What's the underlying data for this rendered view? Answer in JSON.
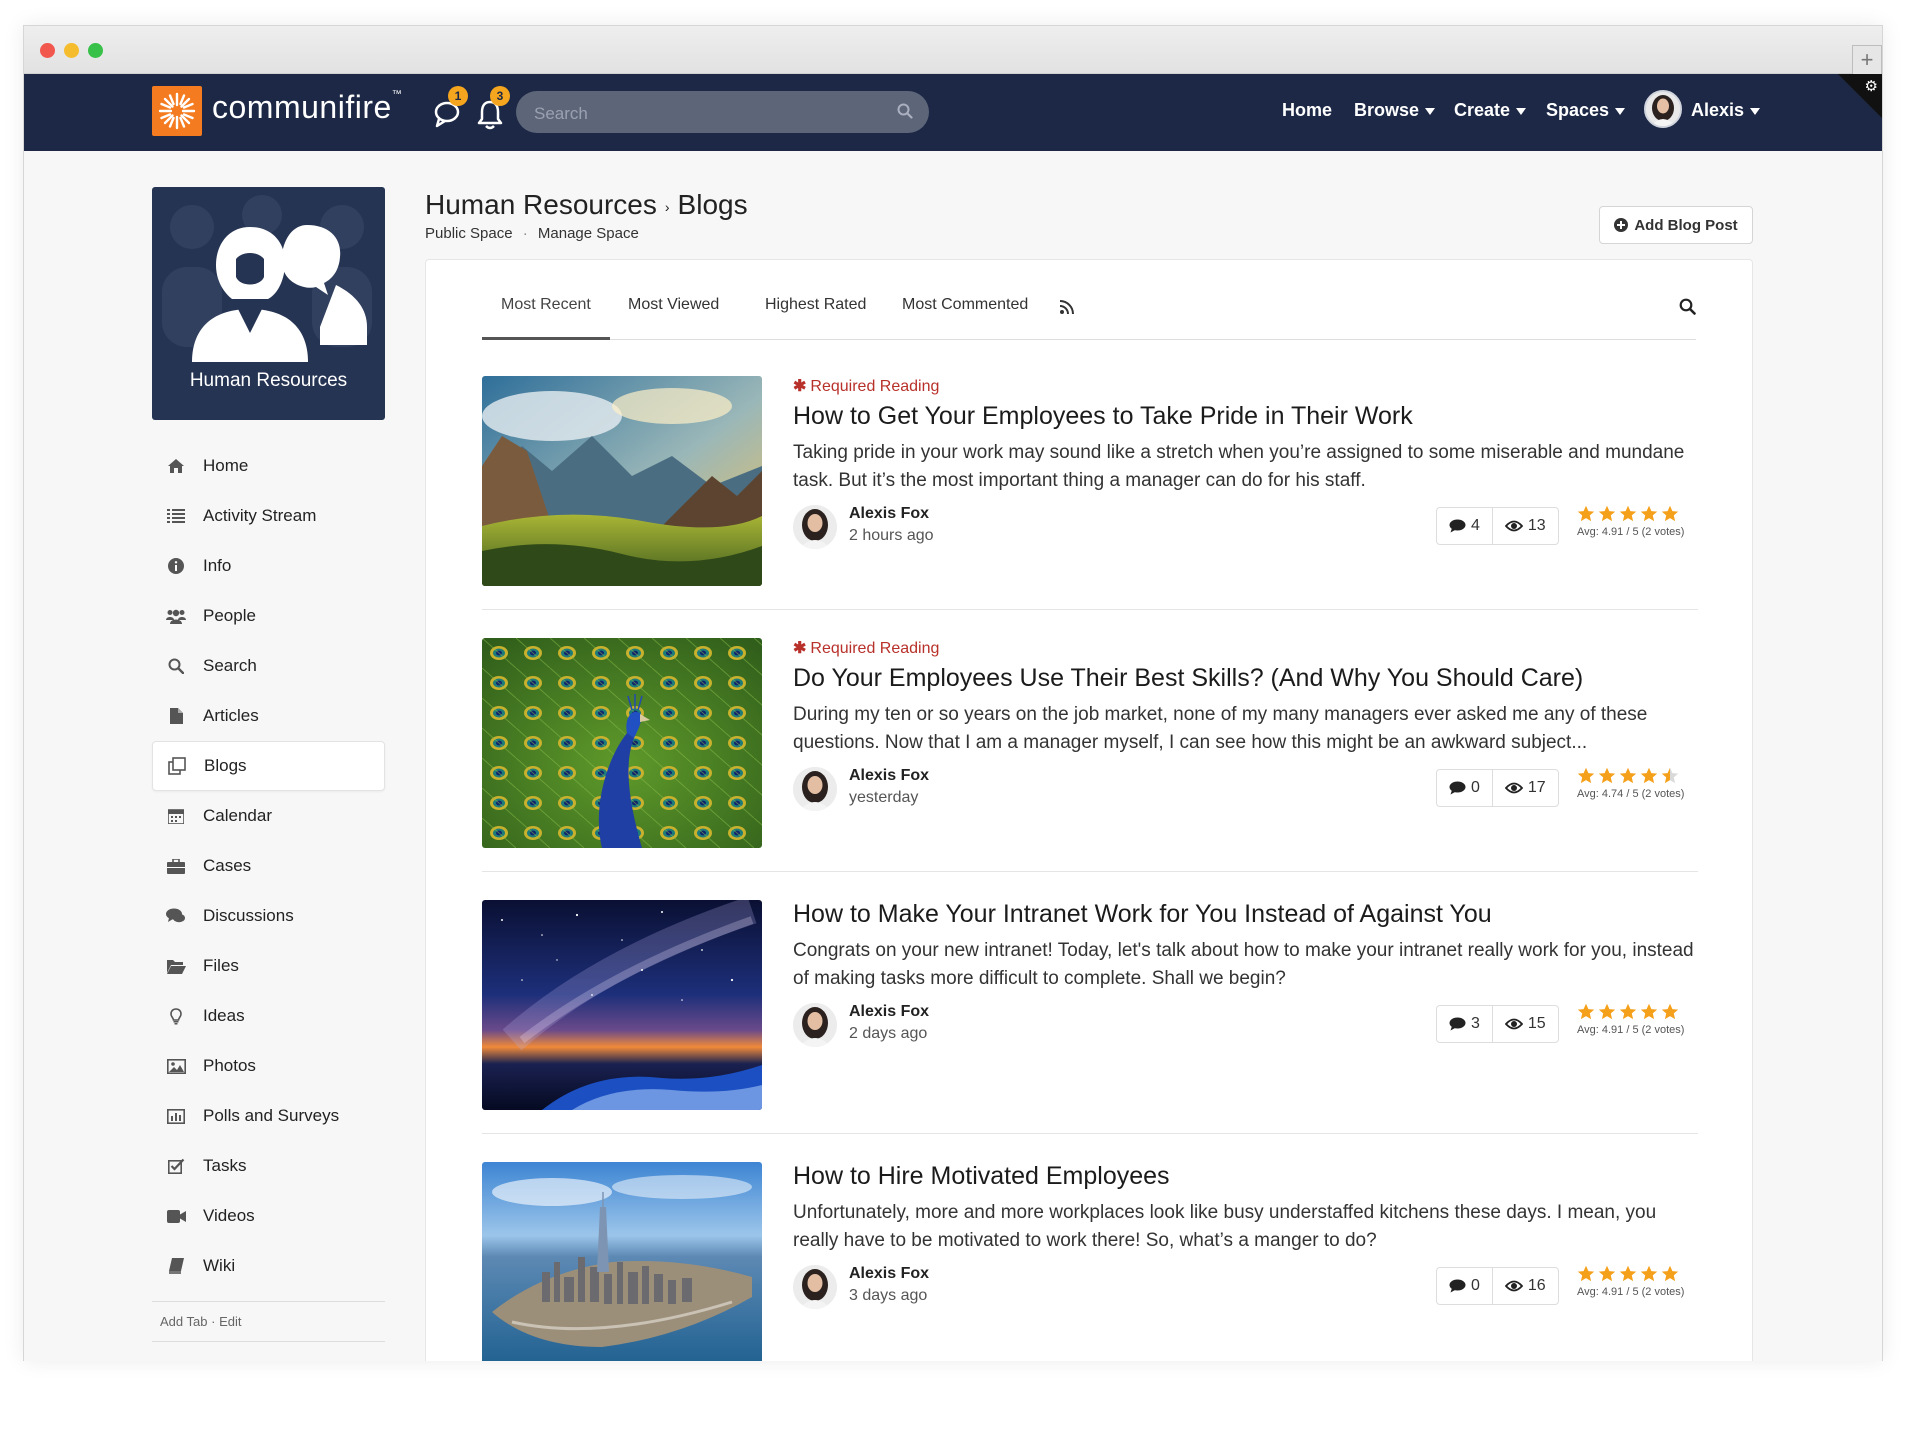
{
  "brand": {
    "name": "communifire",
    "tm": "™"
  },
  "header": {
    "chat_badge": "1",
    "notif_badge": "3",
    "search_placeholder": "Search",
    "nav": [
      {
        "label": "Home"
      },
      {
        "label": "Browse"
      },
      {
        "label": "Create"
      },
      {
        "label": "Spaces"
      }
    ],
    "user": "Alexis"
  },
  "space": {
    "name": "Human Resources"
  },
  "sidebar": {
    "items": [
      {
        "label": "Home",
        "icon": "home-icon"
      },
      {
        "label": "Activity Stream",
        "icon": "list-icon"
      },
      {
        "label": "Info",
        "icon": "info-icon"
      },
      {
        "label": "People",
        "icon": "people-icon"
      },
      {
        "label": "Search",
        "icon": "search-icon"
      },
      {
        "label": "Articles",
        "icon": "article-icon"
      },
      {
        "label": "Blogs",
        "icon": "blogs-icon"
      },
      {
        "label": "Calendar",
        "icon": "calendar-icon"
      },
      {
        "label": "Cases",
        "icon": "briefcase-icon"
      },
      {
        "label": "Discussions",
        "icon": "comments-icon"
      },
      {
        "label": "Files",
        "icon": "folder-icon"
      },
      {
        "label": "Ideas",
        "icon": "lightbulb-icon"
      },
      {
        "label": "Photos",
        "icon": "image-icon"
      },
      {
        "label": "Polls and Surveys",
        "icon": "bar-chart-icon"
      },
      {
        "label": "Tasks",
        "icon": "checkbox-icon"
      },
      {
        "label": "Videos",
        "icon": "video-icon"
      },
      {
        "label": "Wiki",
        "icon": "book-icon"
      }
    ],
    "active_index": 6,
    "footer_add": "Add Tab",
    "footer_sep": "·",
    "footer_edit": "Edit"
  },
  "page": {
    "breadcrumb_parent": "Human Resources",
    "breadcrumb_sep": "›",
    "breadcrumb_current": "Blogs",
    "public_space": "Public Space",
    "sub_sep": "·",
    "manage_space": "Manage Space",
    "add_button": "Add Blog Post"
  },
  "tabs": [
    {
      "label": "Most Recent"
    },
    {
      "label": "Most Viewed"
    },
    {
      "label": "Highest Rated"
    },
    {
      "label": "Most Commented"
    }
  ],
  "posts": [
    {
      "required": "Required Reading",
      "title": "How to Get Your Employees to Take Pride in Their Work",
      "excerpt": "Taking pride in your work may sound like a stretch when you’re assigned to some miserable and mundane task. But it’s the most important thing a manager can do for his staff.",
      "author": "Alexis Fox",
      "time": "2 hours ago",
      "comments": "4",
      "views": "13",
      "stars": 5,
      "rating": "Avg: 4.91 / 5 (2 votes)",
      "image": "mountain-landscape"
    },
    {
      "required": "Required Reading",
      "title": "Do Your Employees Use Their Best Skills? (And Why You Should Care)",
      "excerpt": "During my ten or so years on the job market, none of my many managers ever asked me any of these questions. Now that I am a manager myself, I can see how this might be an awkward subject...",
      "author": "Alexis Fox",
      "time": "yesterday",
      "comments": "0",
      "views": "17",
      "stars": 4.5,
      "rating": "Avg: 4.74 / 5 (2 votes)",
      "image": "peacock"
    },
    {
      "required": "",
      "title": "How to Make Your Intranet Work for You Instead of Against You",
      "excerpt": "Congrats on your new intranet! Today, let's talk about how to make your intranet really work for you, instead of making tasks more difficult to complete. Shall we begin?",
      "author": "Alexis Fox",
      "time": "2 days ago",
      "comments": "3",
      "views": "15",
      "stars": 5,
      "rating": "Avg: 4.91 / 5 (2 votes)",
      "image": "night-sky"
    },
    {
      "required": "",
      "title": "How to Hire Motivated Employees",
      "excerpt": "Unfortunately, more and more workplaces look like busy understaffed kitchens these days. I mean, you really have to be motivated to work there! So, what’s a manger to do?",
      "author": "Alexis Fox",
      "time": "3 days ago",
      "comments": "0",
      "views": "16",
      "stars": 5,
      "rating": "Avg: 4.91 / 5 (2 votes)",
      "image": "city-aerial"
    }
  ],
  "colors": {
    "navbar": "#1c2845",
    "brand_orange": "#f47b1f",
    "required_red": "#b8302a",
    "star_orange": "#f5a01a"
  }
}
